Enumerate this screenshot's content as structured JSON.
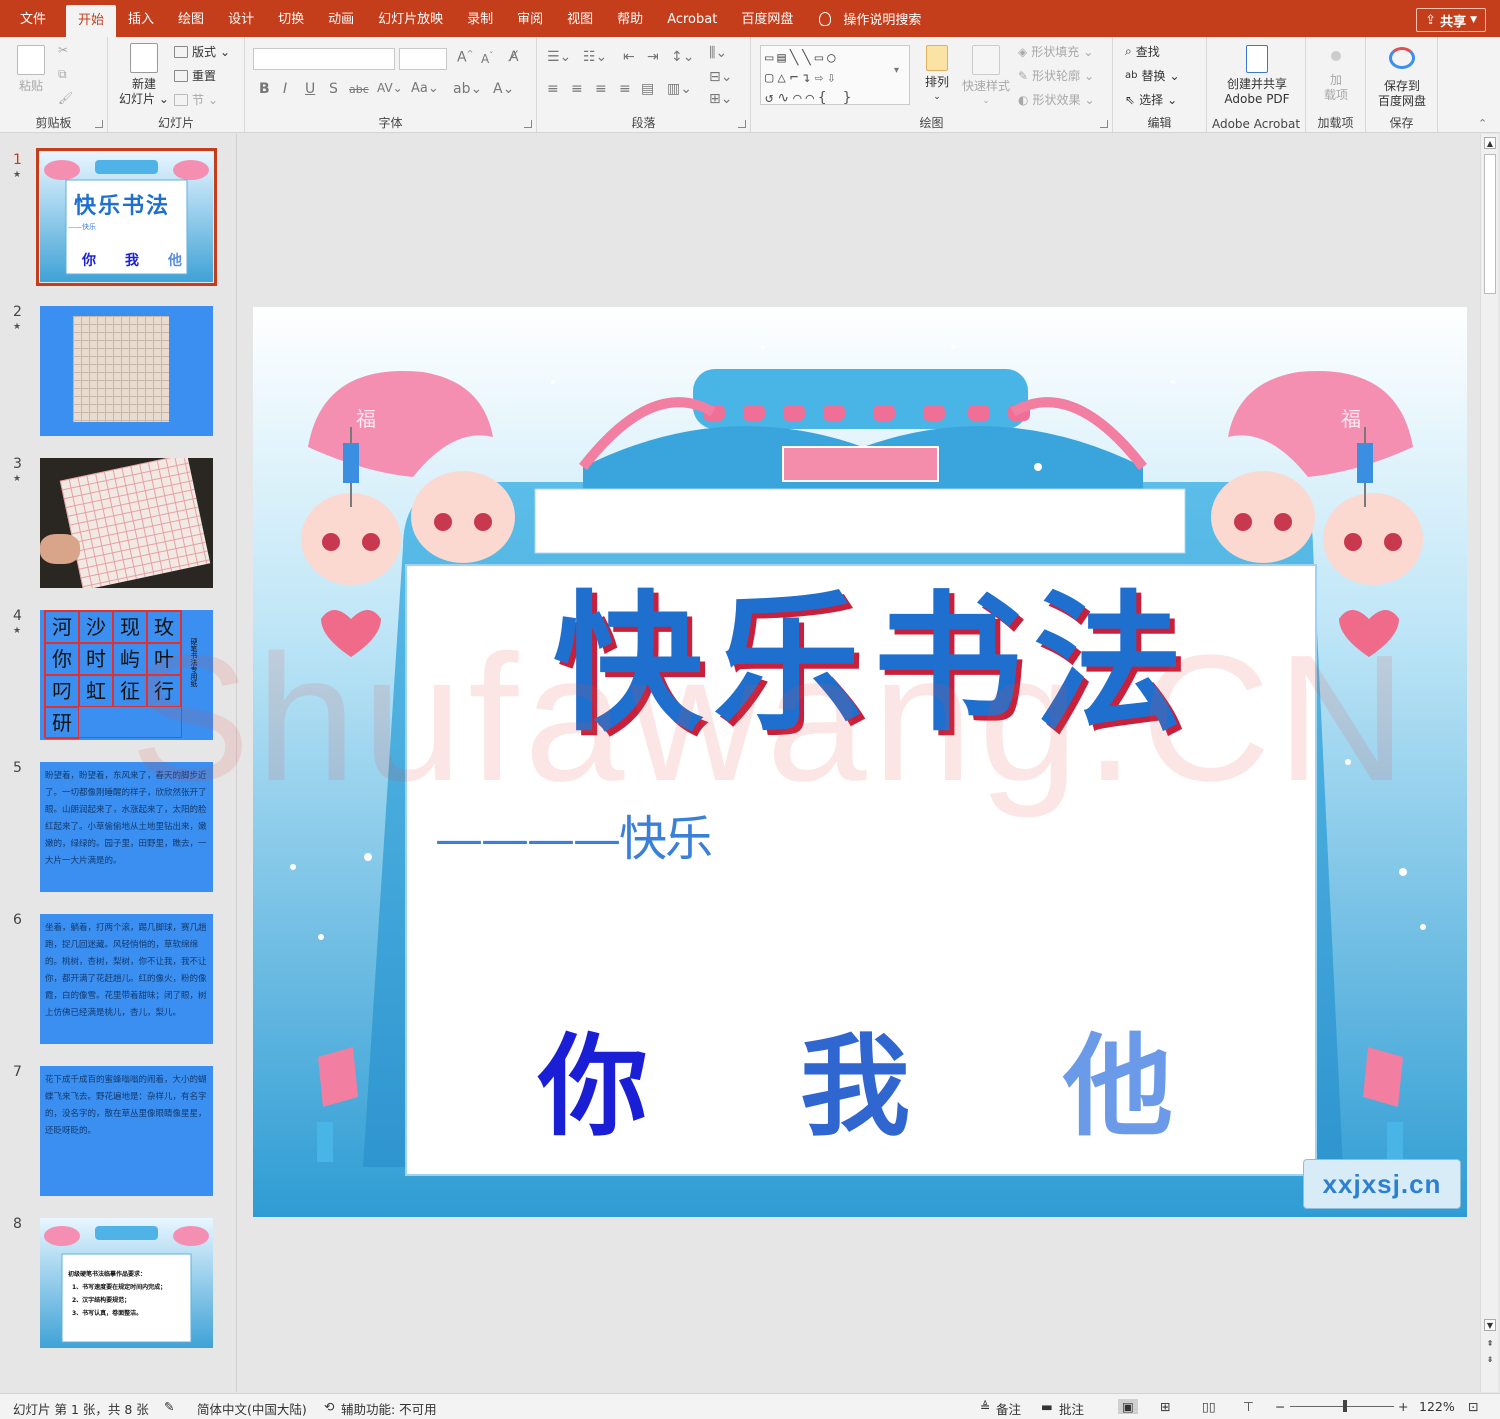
{
  "tabs": [
    {
      "label": "文件"
    },
    {
      "label": "开始"
    },
    {
      "label": "插入"
    },
    {
      "label": "绘图"
    },
    {
      "label": "设计"
    },
    {
      "label": "切换"
    },
    {
      "label": "动画"
    },
    {
      "label": "幻灯片放映"
    },
    {
      "label": "录制"
    },
    {
      "label": "审阅"
    },
    {
      "label": "视图"
    },
    {
      "label": "帮助"
    },
    {
      "label": "Acrobat"
    },
    {
      "label": "百度网盘"
    }
  ],
  "tell_me": "操作说明搜索",
  "share_label": "共享",
  "ribbon": {
    "clipboard": {
      "paste": "粘贴",
      "label": "剪贴板"
    },
    "slides": {
      "new_slide_1": "新建",
      "new_slide_2": "幻灯片",
      "layout": "版式",
      "reset": "重置",
      "section": "节",
      "label": "幻灯片"
    },
    "font": {
      "label": "字体",
      "aa": "Aa"
    },
    "paragraph": {
      "label": "段落"
    },
    "drawing": {
      "arrange": "排列",
      "quick_styles": "快速样式",
      "shape_fill": "形状填充",
      "shape_outline": "形状轮廓",
      "shape_effects": "形状效果",
      "label": "绘图"
    },
    "editing": {
      "find": "查找",
      "replace": "替换",
      "select": "选择",
      "label": "编辑"
    },
    "acrobat": {
      "create_1": "创建并共享",
      "create_2": "Adobe PDF",
      "label": "Adobe Acrobat"
    },
    "addins": {
      "btn_1": "加",
      "btn_2": "载项",
      "label": "加载项"
    },
    "save": {
      "btn_1": "保存到",
      "btn_2": "百度网盘",
      "label": "保存"
    }
  },
  "thumbnails": [
    {
      "num": "1",
      "title": "快乐书法",
      "sub": "——快乐",
      "chars": [
        "你",
        "我",
        "他"
      ]
    },
    {
      "num": "2"
    },
    {
      "num": "3"
    },
    {
      "num": "4",
      "grid": [
        "河",
        "沙",
        "现",
        "玫",
        "你",
        "时",
        "屿",
        "叶",
        "叼",
        "虹",
        "征",
        "行",
        "研"
      ],
      "side": "硬笔书法专用纸"
    },
    {
      "num": "5",
      "text": "盼望着，盼望着，东风来了，春天的脚步近了。一切都像刚睡醒的样子，欣欣然张开了眼。山朗润起来了，水涨起来了，太阳的脸红起来了。小草偷偷地从土地里钻出来，嫩嫩的，绿绿的。园子里，田野里，瞧去，一大片一大片满是的。"
    },
    {
      "num": "6",
      "text": "坐着，躺着，打两个滚，踢几脚球，赛几趟跑，捉几回迷藏。风轻悄悄的，草软绵绵的。桃树，杏树，梨树，你不让我，我不让你，都开满了花赶趟儿。红的像火，粉的像霞，白的像雪。花里带着甜味；闭了眼，树上仿佛已经满是桃儿，杏儿，梨儿。"
    },
    {
      "num": "7",
      "text": "花下成千成百的蜜蜂嗡嗡的闹着，大小的蝴蝶飞来飞去。野花遍地是：杂样儿，有名字的，没名字的，散在草丛里像眼睛像星星，还眨呀眨的。"
    },
    {
      "num": "8",
      "lines": [
        "初级硬笔书法临摹作品要求：",
        "1、书写速度要在规定时间内完成；",
        "2、汉字结构要规范；",
        "3、书写认真，卷面整洁。"
      ]
    }
  ],
  "slide": {
    "title": "快乐书法",
    "subtitle": "————快乐",
    "chars": [
      "你",
      "我",
      "他"
    ],
    "char_colors": [
      "#1a1fd6",
      "#2f66d0",
      "#6a9ae8"
    ],
    "seal": "福",
    "logo": "xxjxsj.cn"
  },
  "watermark": "Shufawang.CN",
  "status": {
    "slide_info": "幻灯片 第 1 张，共 8 张",
    "language": "简体中文(中国大陆)",
    "accessibility": "辅助功能: 不可用",
    "notes": "备注",
    "comments": "批注",
    "zoom": "122%"
  }
}
